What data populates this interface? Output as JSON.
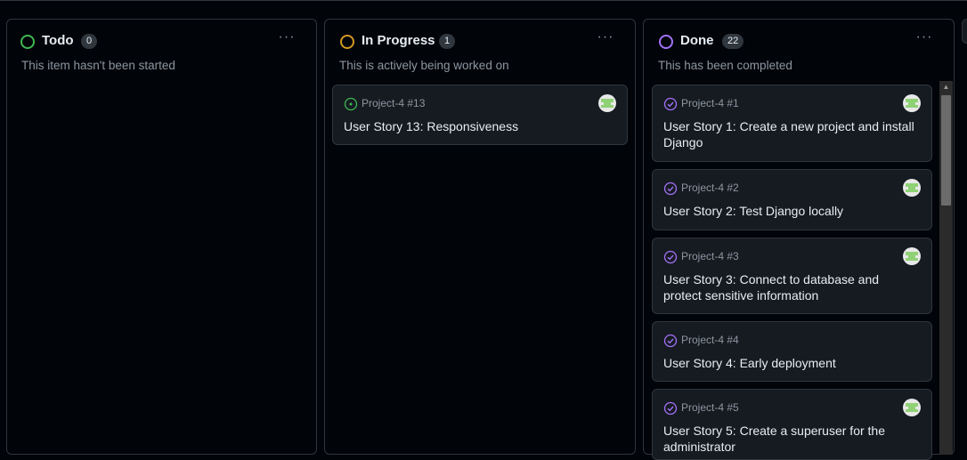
{
  "columns": [
    {
      "title": "Todo",
      "count": "0",
      "description": "This item hasn't been started",
      "status_color": "#3fb950",
      "more_label": "···",
      "cards": []
    },
    {
      "title": "In Progress",
      "count": "1",
      "description": "This is actively being worked on",
      "status_color": "#d29922",
      "more_label": "···",
      "cards": [
        {
          "ref": "Project-4 #13",
          "title": "User Story 13: Responsiveness",
          "state": "open"
        }
      ]
    },
    {
      "title": "Done",
      "count": "22",
      "description": "This has been completed",
      "status_color": "#a371f7",
      "more_label": "···",
      "cards": [
        {
          "ref": "Project-4 #1",
          "title": "User Story 1: Create a new project and install Django",
          "state": "closed"
        },
        {
          "ref": "Project-4 #2",
          "title": "User Story 2: Test Django locally",
          "state": "closed"
        },
        {
          "ref": "Project-4 #3",
          "title": "User Story 3: Connect to database and protect sensitive information",
          "state": "closed"
        },
        {
          "ref": "Project-4 #4",
          "title": "User Story 4: Early deployment",
          "state": "closed"
        },
        {
          "ref": "Project-4 #5",
          "title": "User Story 5: Create a superuser for the administrator",
          "state": "closed"
        }
      ]
    }
  ],
  "icons": {
    "open_issue": "issue-opened-icon",
    "closed_issue": "issue-closed-icon",
    "more": "kebab-horizontal-icon",
    "avatar": "avatar"
  },
  "colors": {
    "background": "#010409",
    "card": "#161b22",
    "border": "#30363d",
    "muted_text": "#8d96a0",
    "open_green": "#3fb950",
    "done_purple": "#a371f7"
  }
}
